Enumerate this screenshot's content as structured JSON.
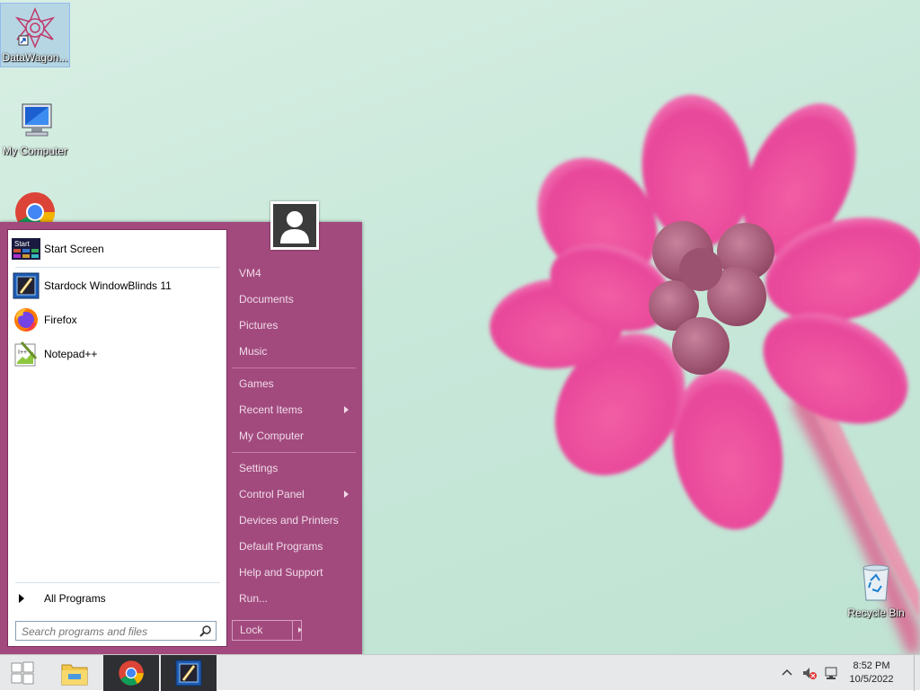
{
  "desktop": {
    "icons": [
      {
        "label": "DataWagon..."
      },
      {
        "label": "My Computer"
      },
      {
        "label": "Recycle Bin"
      }
    ]
  },
  "start_menu": {
    "pinned": [
      {
        "label": "Start Screen",
        "icon": "start-screen-icon",
        "badge": "Start"
      },
      {
        "label": "Stardock WindowBlinds 11",
        "icon": "windowblinds-icon"
      },
      {
        "label": "Firefox",
        "icon": "firefox-icon"
      },
      {
        "label": "Notepad++",
        "icon": "notepad-plus-plus-icon"
      }
    ],
    "all_programs": "All Programs",
    "search_placeholder": "Search programs and files",
    "right_items": [
      {
        "label": "VM4"
      },
      {
        "label": "Documents"
      },
      {
        "label": "Pictures"
      },
      {
        "label": "Music"
      },
      {
        "label": "Games"
      },
      {
        "label": "Recent Items"
      },
      {
        "label": "My Computer"
      },
      {
        "label": "Settings"
      },
      {
        "label": "Control Panel"
      },
      {
        "label": "Devices and Printers"
      },
      {
        "label": "Default Programs"
      },
      {
        "label": "Help and Support"
      },
      {
        "label": "Run..."
      }
    ],
    "lock_label": "Lock",
    "accent_color": "#a24a7e"
  },
  "taskbar": {
    "time": "8:52 PM",
    "date": "10/5/2022",
    "apps": [
      "start-icon",
      "file-explorer-icon",
      "chrome-icon",
      "windowblinds-icon"
    ]
  }
}
